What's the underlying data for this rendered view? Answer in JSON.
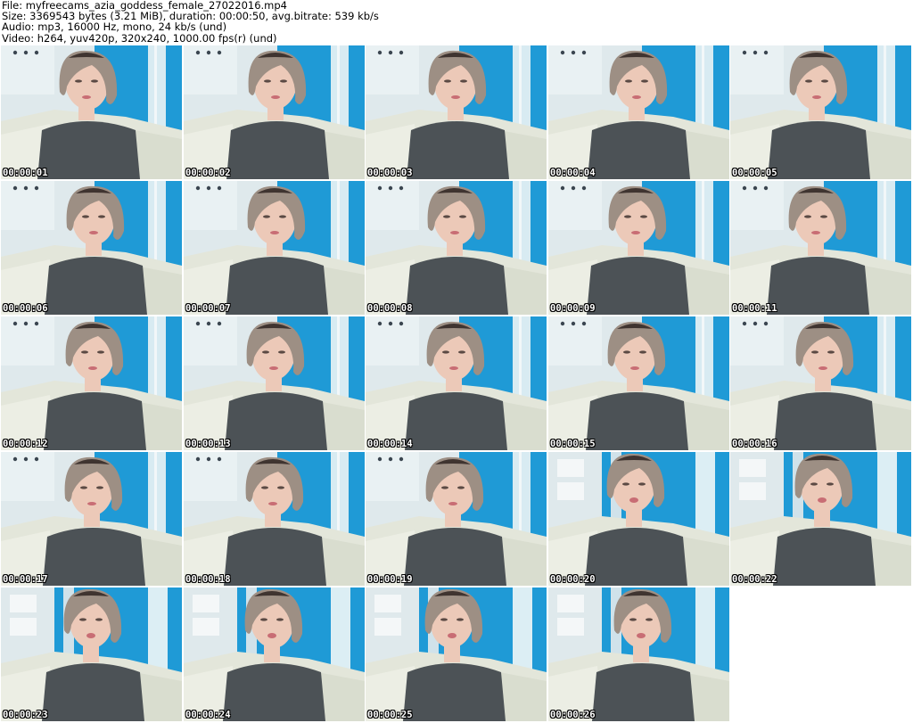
{
  "header": {
    "file": "File: myfreecams_azia_goddess_female_27022016.mp4",
    "size": "Size: 3369543 bytes (3.21 MiB), duration: 00:00:50, avg.bitrate: 539 kb/s",
    "audio": "Audio: mp3, 16000 Hz, mono, 24 kb/s (und)",
    "video": "Video: h264, yuv420p, 320x240, 1000.00 fps(r) (und)"
  },
  "frames": [
    {
      "time": "00:00:01",
      "variant": "a"
    },
    {
      "time": "00:00:02",
      "variant": "a"
    },
    {
      "time": "00:00:03",
      "variant": "a"
    },
    {
      "time": "00:00:04",
      "variant": "a"
    },
    {
      "time": "00:00:05",
      "variant": "a"
    },
    {
      "time": "00:00:06",
      "variant": "a"
    },
    {
      "time": "00:00:07",
      "variant": "a"
    },
    {
      "time": "00:00:08",
      "variant": "a"
    },
    {
      "time": "00:00:09",
      "variant": "a"
    },
    {
      "time": "00:00:11",
      "variant": "a"
    },
    {
      "time": "00:00:12",
      "variant": "a"
    },
    {
      "time": "00:00:13",
      "variant": "a"
    },
    {
      "time": "00:00:14",
      "variant": "a"
    },
    {
      "time": "00:00:15",
      "variant": "a"
    },
    {
      "time": "00:00:16",
      "variant": "a"
    },
    {
      "time": "00:00:17",
      "variant": "a"
    },
    {
      "time": "00:00:18",
      "variant": "a"
    },
    {
      "time": "00:00:19",
      "variant": "a"
    },
    {
      "time": "00:00:20",
      "variant": "b"
    },
    {
      "time": "00:00:22",
      "variant": "b"
    },
    {
      "time": "00:00:23",
      "variant": "b"
    },
    {
      "time": "00:00:24",
      "variant": "b"
    },
    {
      "time": "00:00:25",
      "variant": "b"
    },
    {
      "time": "00:00:26",
      "variant": "b"
    }
  ],
  "colors": {
    "wall_blue": "#1f9ad6",
    "wall_light": "#dfe9ec",
    "sofa": "#e3e6da",
    "shirt": "#4c5256",
    "skin": "#ecc9b8",
    "hair": "#9d8f84",
    "hair_dark": "#3f3430",
    "lips": "#c86d74",
    "timestamp_text": "#ffffff"
  }
}
